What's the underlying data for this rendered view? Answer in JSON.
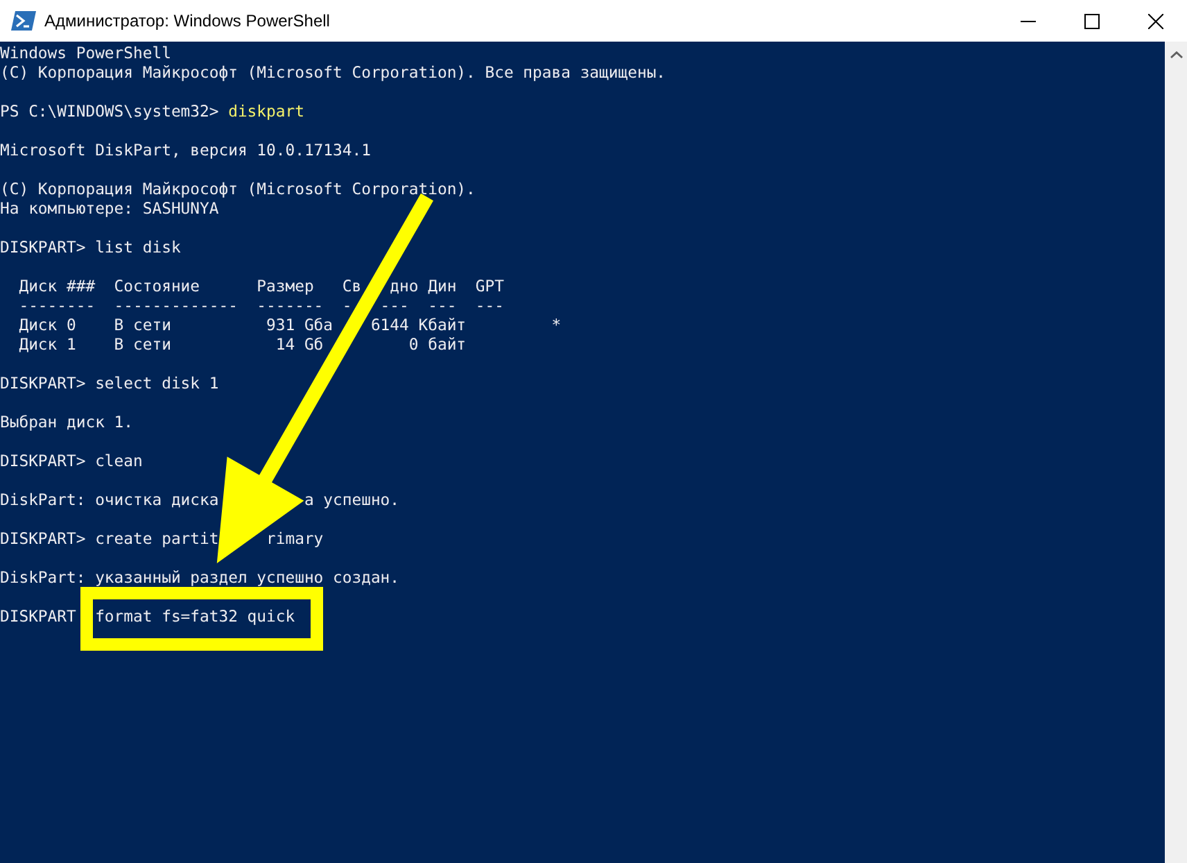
{
  "window": {
    "title": "Администратор: Windows PowerShell"
  },
  "console": {
    "blocks": [
      [
        {
          "kind": "output",
          "text": "Windows PowerShell"
        },
        {
          "kind": "output",
          "text": "(C) Корпорация Майкрософт (Microsoft Corporation). Все права защищены."
        }
      ],
      [
        {
          "kind": "ps",
          "prompt": "PS C:\\WINDOWS\\system32> ",
          "command": "diskpart"
        }
      ],
      [
        {
          "kind": "output",
          "text": "Microsoft DiskPart, версия 10.0.17134.1"
        }
      ],
      [
        {
          "kind": "output",
          "text": "(C) Корпорация Майкрософт (Microsoft Corporation)."
        },
        {
          "kind": "output",
          "text": "На компьютере: SASHUNYA"
        }
      ],
      [
        {
          "kind": "output",
          "text": "DISKPART> list disk"
        }
      ],
      [
        {
          "kind": "output",
          "text": "  Диск ###  Состояние      Размер   Св   дно Дин  GPT"
        },
        {
          "kind": "output",
          "text": "  --------  -------------  -------  -   ---  ---  ---"
        },
        {
          "kind": "output",
          "text": "  Диск 0    В сети          931 Gба    6144 Кбайт         *"
        },
        {
          "kind": "output",
          "text": "  Диск 1    В сети           14 Gб         0 байт"
        }
      ],
      [
        {
          "kind": "output",
          "text": "DISKPART> select disk 1"
        }
      ],
      [
        {
          "kind": "output",
          "text": "Выбран диск 1."
        }
      ],
      [
        {
          "kind": "output",
          "text": "DISKPART> clean"
        }
      ],
      [
        {
          "kind": "output",
          "text": "DiskPart: очистка диска         а успешно."
        }
      ],
      [
        {
          "kind": "output",
          "text": "DISKPART> create partit     rimary"
        }
      ],
      [
        {
          "kind": "output",
          "text": "DiskPart: указанный раздел успешно создан."
        }
      ],
      [
        {
          "kind": "output",
          "text": "DISKPART  format fs=fat32 quick"
        }
      ]
    ]
  }
}
